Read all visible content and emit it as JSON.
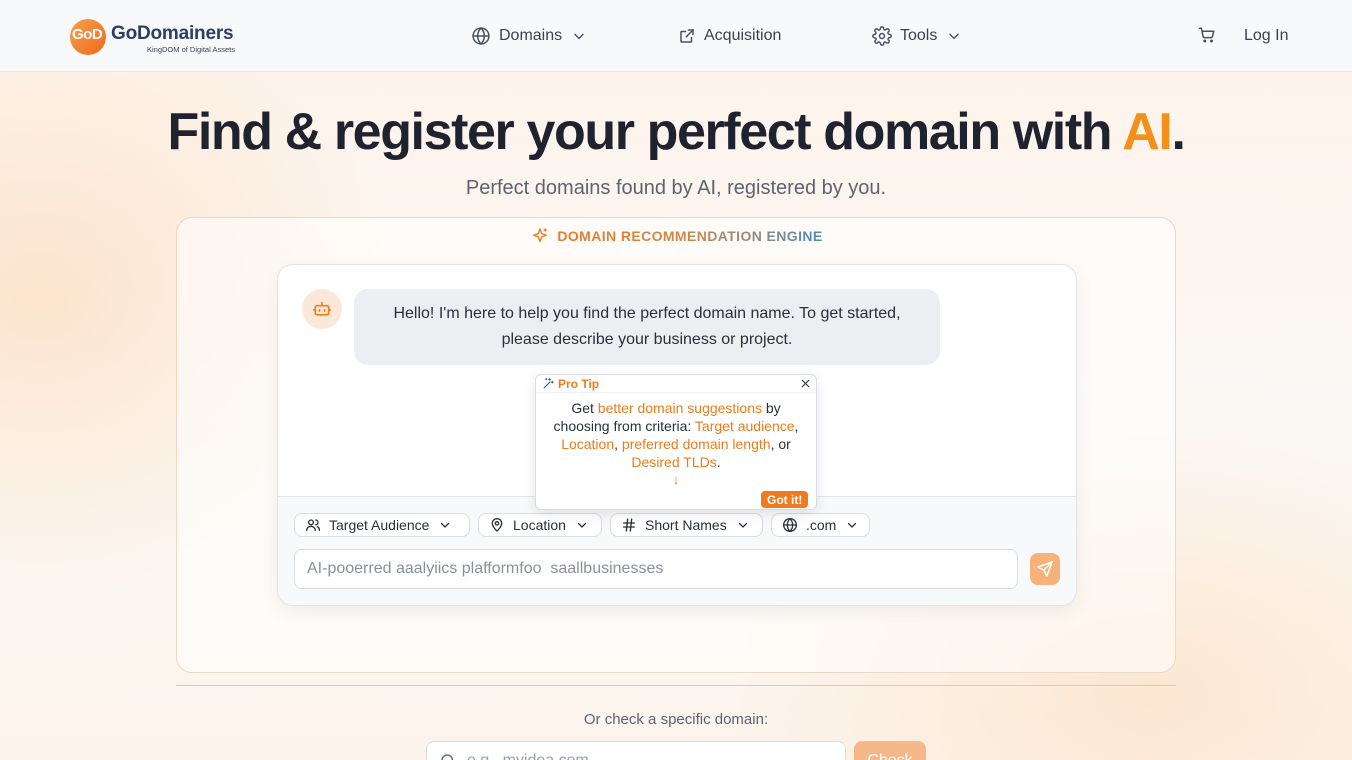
{
  "brand": {
    "mark": "GoD",
    "name": "GoDomainers",
    "tagline": "KingDOM of Digital Assets",
    "accent_color": "#f39019"
  },
  "nav": {
    "items": [
      {
        "label": "Domains",
        "icon": "globe-icon",
        "has_dropdown": true
      },
      {
        "label": "Acquisition",
        "icon": "external-link-icon",
        "has_dropdown": false
      },
      {
        "label": "Tools",
        "icon": "gear-icon",
        "has_dropdown": true
      }
    ],
    "cart_icon": "cart-icon",
    "login_label": "Log In"
  },
  "hero": {
    "title_main": "Find & register your perfect domain with ",
    "title_accent": "AI",
    "title_end": ".",
    "subtitle": "Perfect domains found by AI, registered by you."
  },
  "engine": {
    "label": "DOMAIN RECOMMENDATION ENGINE",
    "bot_message": "Hello! I'm here to help you find the perfect domain name. To get started, please describe your business or project.",
    "filters": [
      {
        "label": "Target Audience",
        "icon": "users-icon"
      },
      {
        "label": "Location",
        "icon": "map-pin-icon"
      },
      {
        "label": "Short Names",
        "icon": "hash-icon"
      },
      {
        "label": ".com",
        "icon": "globe-icon"
      }
    ],
    "prompt_placeholder": "AI-pooerred aaalyiics plafformfoo  saallbusinesses",
    "send_icon": "send-icon"
  },
  "tip": {
    "title": "Pro Tip",
    "t1": "Get ",
    "h1": "better domain suggestions",
    "t2": " by choosing from criteria: ",
    "h2": "Target audience",
    "t3": ", ",
    "h3": "Location",
    "t4": ", ",
    "h4": "preferred domain length",
    "t5": ", or ",
    "h5": "Desired TLDs",
    "t6": ".",
    "arrow": "↓",
    "button": "Got it!"
  },
  "check": {
    "label": "Or check a specific domain:",
    "placeholder": "e.g., myidea.com",
    "button": "Check"
  }
}
